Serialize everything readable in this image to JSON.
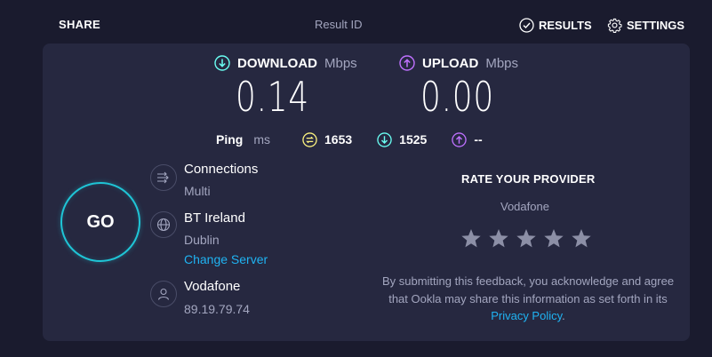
{
  "header": {
    "share": "SHARE",
    "result_id": "Result ID",
    "results": "RESULTS",
    "settings": "SETTINGS"
  },
  "download": {
    "label": "DOWNLOAD",
    "unit": "Mbps",
    "value": "0.14",
    "icon": "download-arrow-icon",
    "color": "#6afff3"
  },
  "upload": {
    "label": "UPLOAD",
    "unit": "Mbps",
    "value": "0.00",
    "icon": "upload-arrow-icon",
    "color": "#bf71ff"
  },
  "ping": {
    "label": "Ping",
    "unit": "ms",
    "idle": "1653",
    "download": "1525",
    "upload": "--",
    "idle_color": "#fbf27f",
    "download_color": "#6afff3",
    "upload_color": "#bf71ff"
  },
  "go": "GO",
  "connections": {
    "title": "Connections",
    "value": "Multi"
  },
  "server": {
    "isp": "BT Ireland",
    "city": "Dublin",
    "change": "Change Server"
  },
  "client": {
    "provider": "Vodafone",
    "ip": "89.19.79.74"
  },
  "rating": {
    "title": "RATE YOUR PROVIDER",
    "provider": "Vodafone",
    "stars": 5,
    "disclaimer": "By submitting this feedback, you acknowledge and agree that Ookla may share this information as set forth in its ",
    "privacy_link": "Privacy Policy",
    "period": "."
  }
}
